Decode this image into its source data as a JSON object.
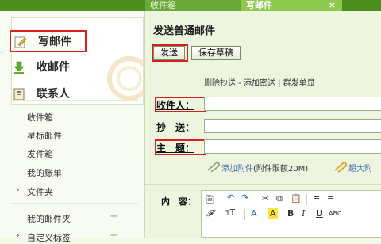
{
  "tabs": {
    "inbox": "收件箱",
    "compose": "写邮件",
    "close": "×"
  },
  "nav": {
    "compose": "写邮件",
    "receive": "收邮件",
    "contacts": "联系人"
  },
  "folders": {
    "inbox": "收件箱",
    "starred": "星标邮件",
    "sent": "发件箱",
    "account": "我的账单",
    "folder": "文件夹",
    "my_folders": "我的邮件夹",
    "custom_tags": "自定义标签"
  },
  "compose": {
    "title": "发送普通邮件",
    "send": "发送",
    "save_draft": "保存草稿",
    "links": "删除抄送 - 添加密送 | 群发单显",
    "to_label": "收件人：",
    "cc_label": "抄　送：",
    "subject_label": "主　题：",
    "attach": "添加附件",
    "attach_limit": "(附件限额20M)",
    "big_attach": "超大附",
    "content_label": "内　容："
  },
  "toolbar": {
    "font": "𝓕",
    "size": "тT",
    "font_color": "A",
    "highlight": "A",
    "bold": "B",
    "italic": "I",
    "underline": "U",
    "abc": "ABC"
  },
  "colors": {
    "accent": "#d62020",
    "header_green": "#4d8f1e",
    "link_blue": "#3a6db0"
  }
}
